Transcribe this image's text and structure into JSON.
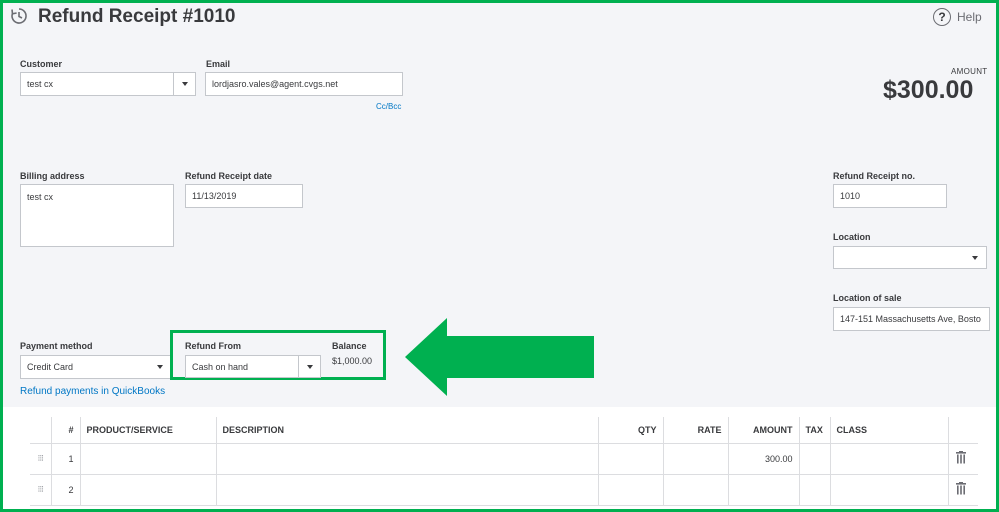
{
  "header": {
    "title": "Refund Receipt #1010",
    "help_label": "Help"
  },
  "customer": {
    "label": "Customer",
    "value": "test cx"
  },
  "email": {
    "label": "Email",
    "value": "lordjasro.vales@agent.cvgs.net",
    "cc_link": "Cc/Bcc"
  },
  "amount": {
    "label": "AMOUNT",
    "value": "$300.00"
  },
  "billing": {
    "label": "Billing address",
    "value": "test cx"
  },
  "receipt_date": {
    "label": "Refund Receipt date",
    "value": "11/13/2019"
  },
  "receipt_no": {
    "label": "Refund Receipt no.",
    "value": "1010"
  },
  "location": {
    "label": "Location",
    "value": ""
  },
  "location_of_sale": {
    "label": "Location of sale",
    "value": "147-151 Massachusetts Ave, Bosto"
  },
  "payment": {
    "label": "Payment method",
    "value": "Credit Card",
    "link": "Refund payments in QuickBooks"
  },
  "refund_from": {
    "label": "Refund From",
    "value": "Cash on hand"
  },
  "balance": {
    "label": "Balance",
    "value": "$1,000.00"
  },
  "table": {
    "headers": [
      "#",
      "PRODUCT/SERVICE",
      "DESCRIPTION",
      "QTY",
      "RATE",
      "AMOUNT",
      "TAX",
      "CLASS"
    ],
    "rows": [
      {
        "num": "1",
        "product": "",
        "description": "",
        "qty": "",
        "rate": "",
        "amount": "300.00",
        "tax": "",
        "class": ""
      },
      {
        "num": "2",
        "product": "",
        "description": "",
        "qty": "",
        "rate": "",
        "amount": "",
        "tax": "",
        "class": ""
      }
    ]
  },
  "colors": {
    "annotation_green": "#00b050",
    "link_blue": "#0077c5",
    "panel_bg": "#f4f5f8"
  }
}
